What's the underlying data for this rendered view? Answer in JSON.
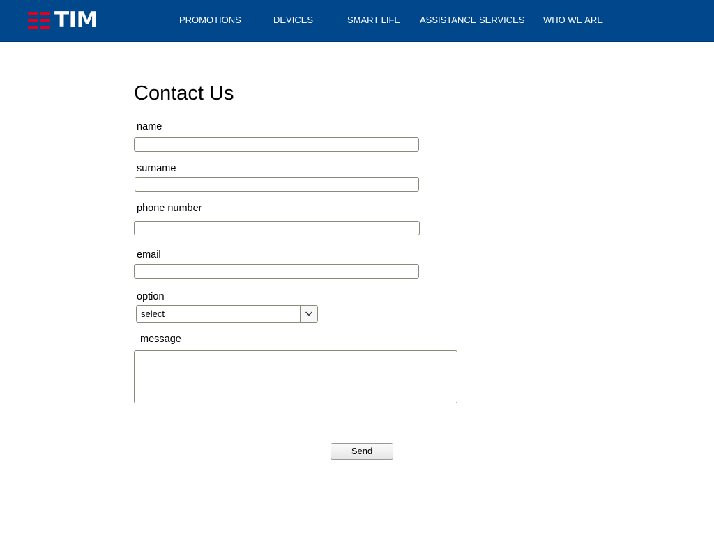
{
  "header": {
    "logo_text": "TIM",
    "brand_color": "#00478c",
    "logo_accent_color": "#e3001b",
    "nav": [
      {
        "label": "PROMOTIONS"
      },
      {
        "label": "DEVICES"
      },
      {
        "label": "SMART LIFE"
      },
      {
        "label": "ASSISTANCE SERVICES"
      },
      {
        "label": "WHO WE ARE"
      }
    ]
  },
  "main": {
    "title": "Contact Us",
    "form": {
      "name_label": "name",
      "name_value": "",
      "surname_label": "surname",
      "surname_value": "",
      "phone_label": "phone number",
      "phone_value": "",
      "email_label": "email",
      "email_value": "",
      "option_label": "option",
      "option_selected": "select",
      "message_label": "message",
      "message_value": "",
      "send_label": "Send"
    }
  }
}
